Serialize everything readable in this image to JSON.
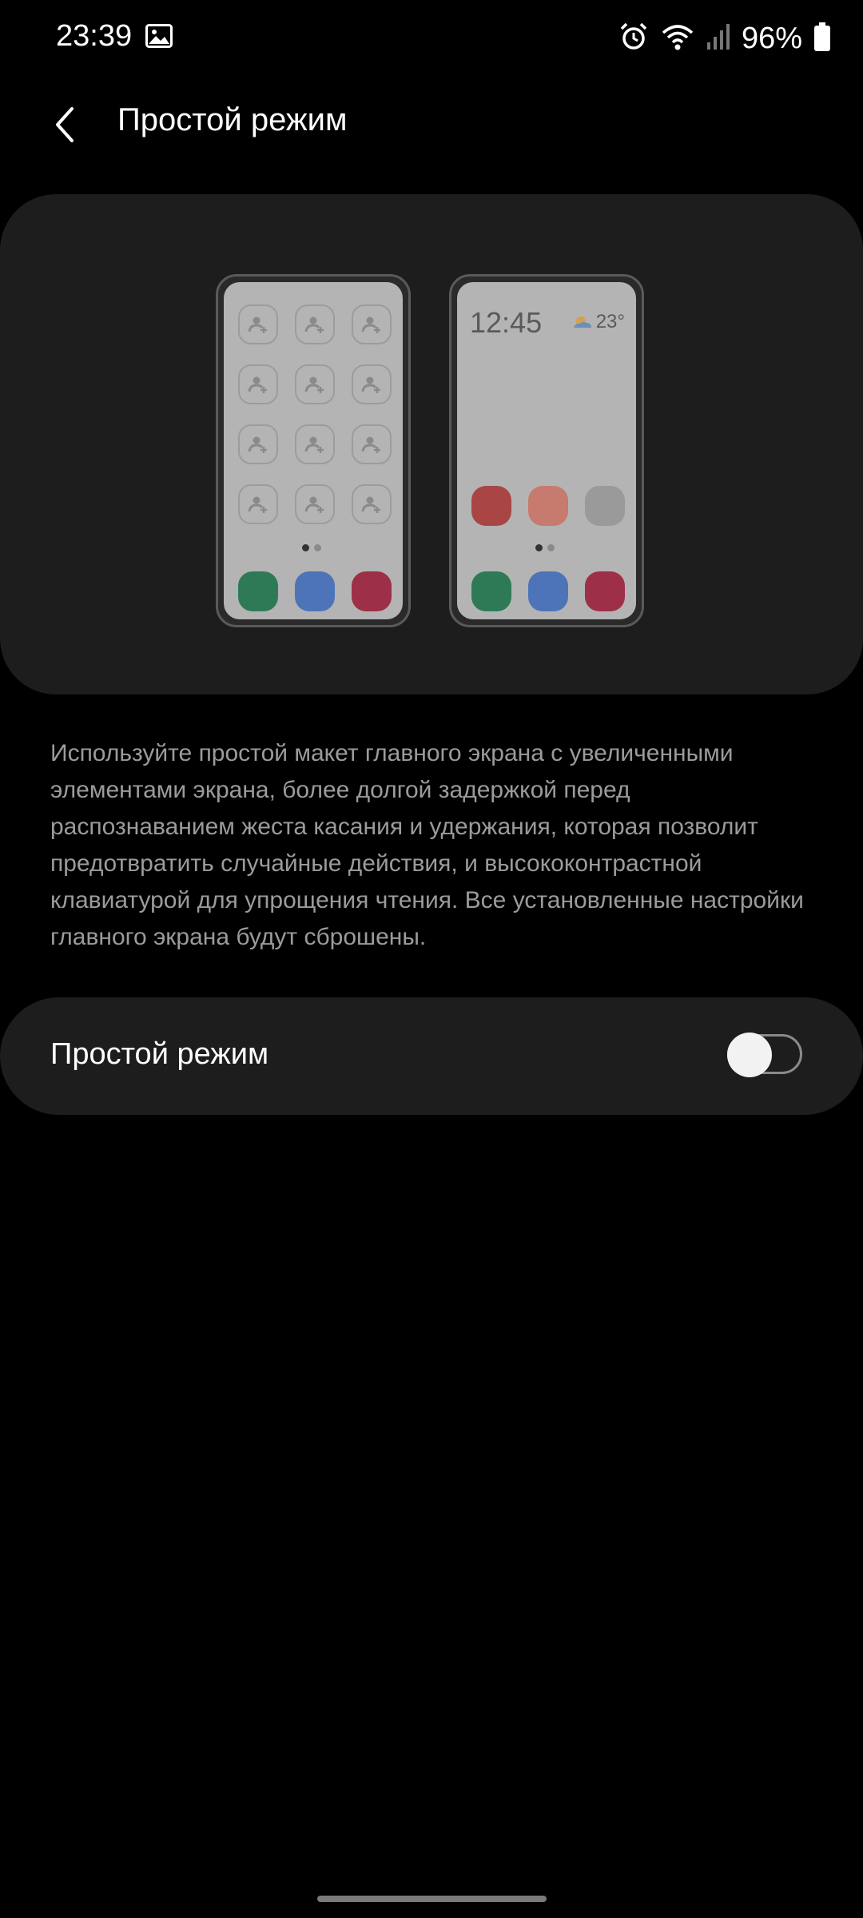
{
  "status_bar": {
    "time": "23:39",
    "battery": "96%",
    "icons": [
      "gallery-icon",
      "alarm-icon",
      "wifi-icon",
      "signal-icon",
      "battery-icon"
    ]
  },
  "app_bar": {
    "title": "Простой режим",
    "back_icon": "back-chevron-icon"
  },
  "illustration": {
    "phone2_time": "12:45",
    "phone2_temp": "23°",
    "weather_icon": "sun-cloud-icon",
    "colors": {
      "green": "#2e7a57",
      "blue": "#4d74b8",
      "crimson": "#9e2f48",
      "red": "#a94545",
      "salmon": "#c77a6e",
      "gray": "#9a9a9a"
    }
  },
  "description": "Используйте простой макет главного экрана с увеличенными элементами экрана, более долгой задержкой перед распознаванием жеста касания и удержания, которая позволит предотвратить случайные действия, и высококонтрастной клавиатурой для упрощения чтения. Все установленные настройки главного экрана будут сброшены.",
  "toggle": {
    "label": "Простой режим",
    "state": "off"
  }
}
